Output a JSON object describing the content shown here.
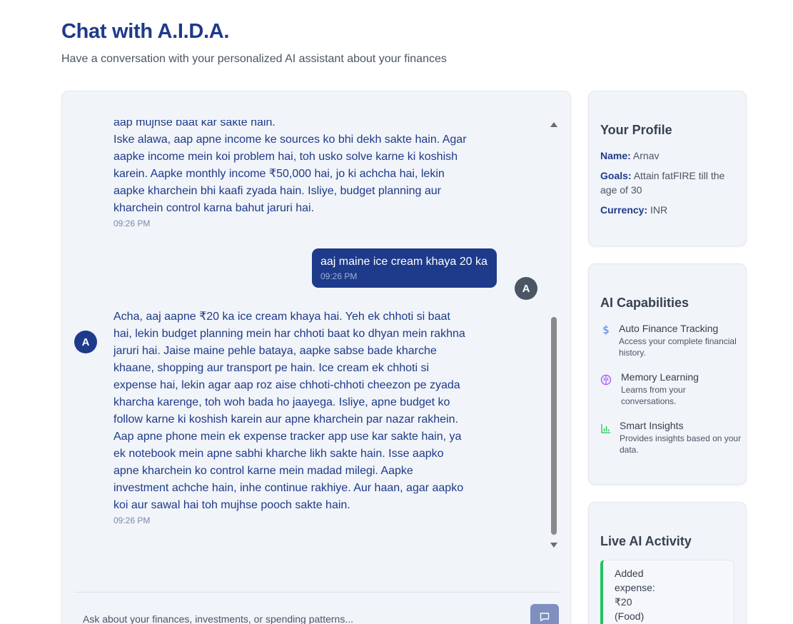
{
  "header": {
    "title": "Chat with A.I.D.A.",
    "subtitle": "Have a conversation with your personalized AI assistant about your finances"
  },
  "chat": {
    "messages": [
      {
        "role": "ai",
        "text": "aap mujhse baat kar sakte hain.\nIske alawa, aap apne income ke sources ko bhi dekh sakte hain.  Agar aapke income mein koi problem hai, toh usko solve karne ki koshish karein.  Aapke monthly income ₹50,000 hai, jo ki achcha hai, lekin aapke kharchein bhi kaafi zyada hain.  Isliye, budget planning aur kharchein control karna bahut jaruri hai.",
        "time": "09:26 PM"
      },
      {
        "role": "user",
        "avatar": "A",
        "text": "aaj maine ice cream khaya 20 ka",
        "time": "09:26 PM"
      },
      {
        "role": "ai",
        "avatar": "A",
        "text": "Acha, aaj aapne ₹20 ka ice cream khaya hai.  Yeh ek chhoti si baat hai, lekin budget planning mein har chhoti baat ko dhyan mein rakhna jaruri hai.  Jaise maine pehle bataya, aapke sabse bade kharche khaane, shopping aur transport pe hain.  Ice cream ek chhoti si expense hai, lekin agar aap roz aise chhoti-chhoti cheezon pe zyada kharcha karenge, toh woh bada ho jaayega.  Isliye, apne budget ko follow karne ki koshish karein aur apne kharchein par nazar rakhein.  Aap apne phone mein ek expense tracker app use kar sakte hain, ya ek notebook mein apne sabhi kharche likh sakte hain.  Isse aapko apne kharchein ko control karne mein madad milegi.  Aapke investment achche hain, inhe continue rakhiye.  Aur haan, agar aapko koi aur sawal hai toh mujhse pooch sakte hain.",
        "time": "09:26 PM"
      }
    ],
    "input_placeholder": "Ask about your finances, investments, or spending patterns..."
  },
  "profile": {
    "title": "Your Profile",
    "name_label": "Name:",
    "name": "Arnav",
    "goals_label": "Goals:",
    "goals": "Attain fatFIRE till the age of 30",
    "currency_label": "Currency:",
    "currency": "INR"
  },
  "capabilities": {
    "title": "AI Capabilities",
    "items": [
      {
        "icon": "dollar-icon",
        "color": "#3b82f6",
        "title": "Auto Finance Tracking",
        "desc": "Access your complete financial history."
      },
      {
        "icon": "brain-icon",
        "color": "#a855f7",
        "title": "Memory Learning",
        "desc": "Learns from your conversations."
      },
      {
        "icon": "bar-chart-icon",
        "color": "#22c55e",
        "title": "Smart Insights",
        "desc": "Provides insights based on your data."
      }
    ]
  },
  "activity": {
    "title": "Live AI Activity",
    "items": [
      {
        "text": "Added expense: ₹20 (Food)",
        "accent": "#22c55e"
      }
    ]
  }
}
